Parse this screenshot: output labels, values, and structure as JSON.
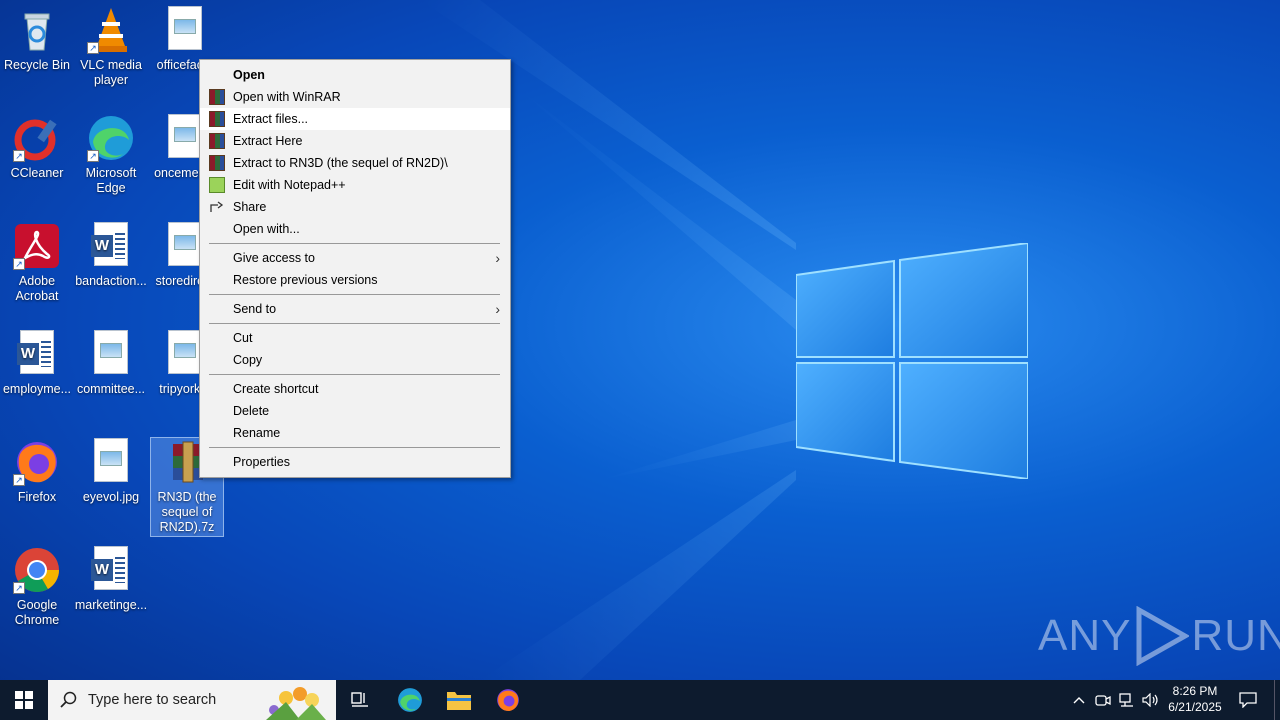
{
  "desktop": {
    "icons": [
      {
        "label": "Recycle Bin"
      },
      {
        "label": "VLC media player"
      },
      {
        "label": "officefac..."
      },
      {
        "label": "CCleaner"
      },
      {
        "label": "Microsoft Edge"
      },
      {
        "label": "oncemen..."
      },
      {
        "label": "Adobe Acrobat"
      },
      {
        "label": "bandaction..."
      },
      {
        "label": "storedire..."
      },
      {
        "label": "employme..."
      },
      {
        "label": "committee..."
      },
      {
        "label": "tripyork..."
      },
      {
        "label": "Firefox"
      },
      {
        "label": "eyevol.jpg"
      },
      {
        "label": "RN3D (the sequel of RN2D).7z"
      },
      {
        "label": "Google Chrome"
      },
      {
        "label": "marketinge..."
      }
    ]
  },
  "context_menu": {
    "items": [
      {
        "label": "Open"
      },
      {
        "label": "Open with WinRAR"
      },
      {
        "label": "Extract files..."
      },
      {
        "label": "Extract Here"
      },
      {
        "label": "Extract to RN3D (the sequel of RN2D)\\"
      },
      {
        "label": "Edit with Notepad++"
      },
      {
        "label": "Share"
      },
      {
        "label": "Open with..."
      },
      {
        "label": "Give access to"
      },
      {
        "label": "Restore previous versions"
      },
      {
        "label": "Send to"
      },
      {
        "label": "Cut"
      },
      {
        "label": "Copy"
      },
      {
        "label": "Create shortcut"
      },
      {
        "label": "Delete"
      },
      {
        "label": "Rename"
      },
      {
        "label": "Properties"
      }
    ]
  },
  "taskbar": {
    "search_placeholder": "Type here to search",
    "time": "8:26 PM",
    "date": "6/21/2025"
  },
  "watermark": {
    "text_any": "ANY",
    "text_run": "RUN"
  },
  "colors": {
    "desktop_blue": "#0a5fd0",
    "taskbar": "#0d1b2e",
    "menu_bg": "#f2f2f2"
  }
}
